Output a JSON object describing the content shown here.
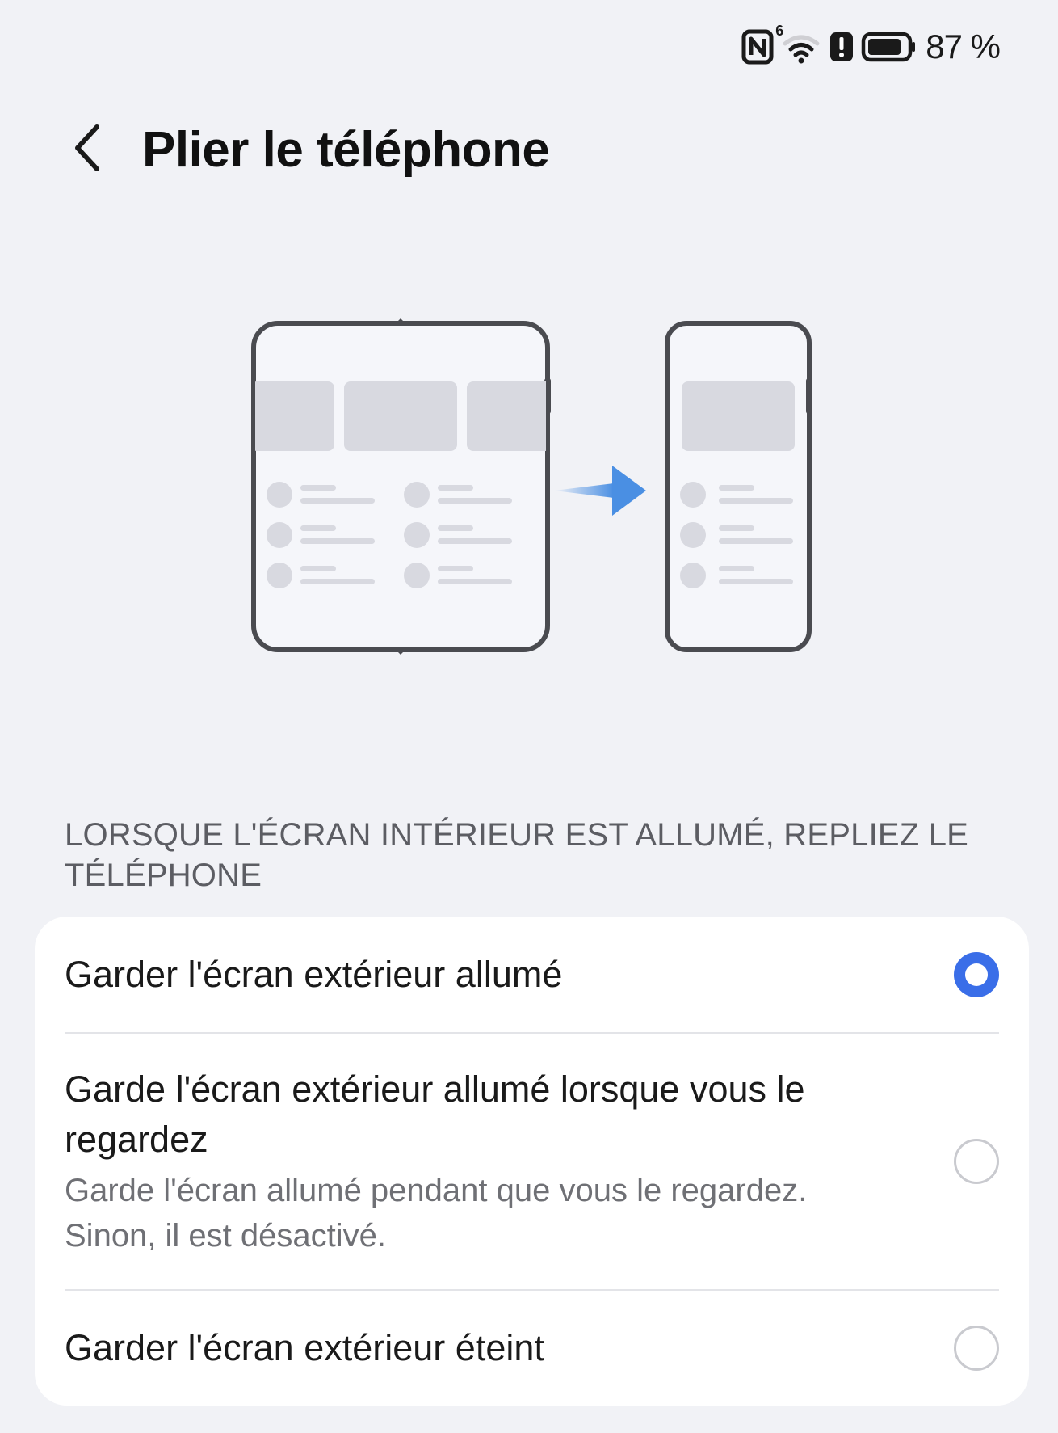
{
  "status_bar": {
    "icons": [
      "nfc-icon",
      "wifi-icon",
      "alert-icon",
      "battery-icon"
    ],
    "wifi_badge": "6",
    "battery_percent": "87 %",
    "battery_level": 0.87
  },
  "header": {
    "back_icon": "chevron-left-icon",
    "title": "Plier le téléphone"
  },
  "illustration": {
    "description_icon": "fold-phone-illustration",
    "arrow_color": "#4a8fe3"
  },
  "section": {
    "header": "LORSQUE L'ÉCRAN INTÉRIEUR EST ALLUMÉ, REPLIEZ LE TÉLÉPHONE"
  },
  "options": [
    {
      "title": "Garder l'écran extérieur allumé",
      "description": "",
      "selected": true
    },
    {
      "title": "Garde l'écran extérieur allumé lorsque vous le regardez",
      "description": "Garde l'écran allumé pendant que vous le regardez. Sinon, il est désactivé.",
      "selected": false
    },
    {
      "title": "Garder l'écran extérieur éteint",
      "description": "",
      "selected": false
    }
  ],
  "colors": {
    "background": "#f1f2f6",
    "card": "#ffffff",
    "accent": "#3a6ee8",
    "section_text": "#5c5d63"
  }
}
